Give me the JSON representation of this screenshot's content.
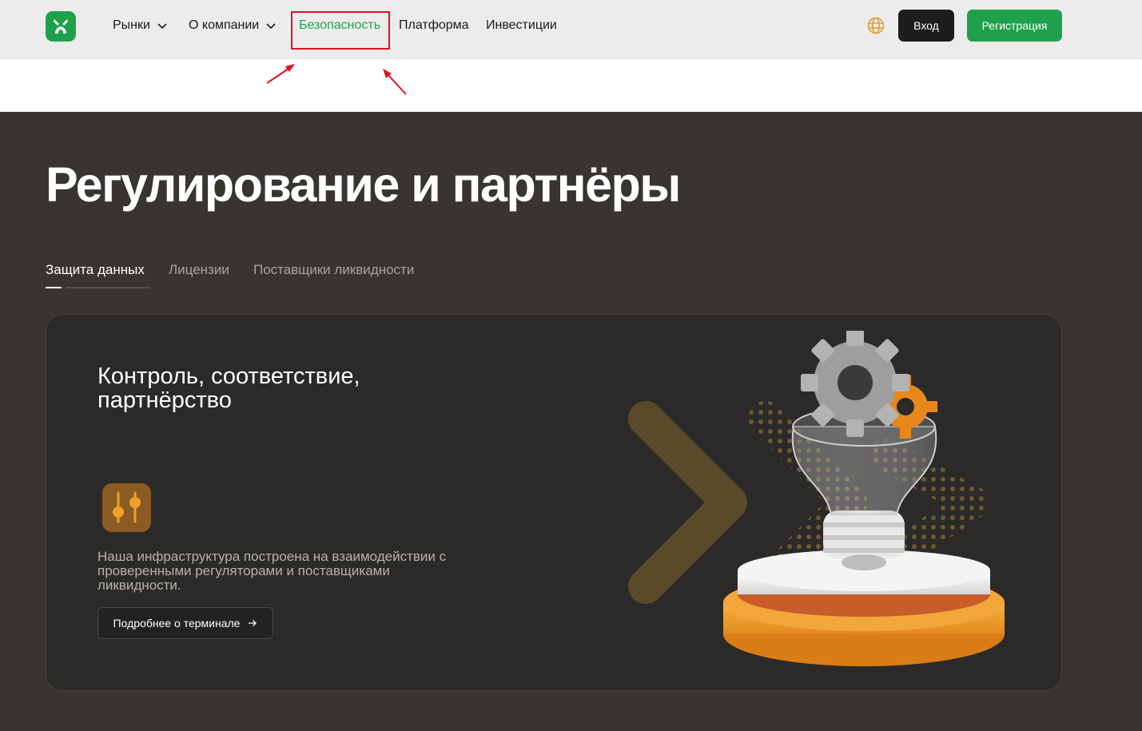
{
  "header": {
    "nav": [
      {
        "label": "Рынки",
        "has_dropdown": true
      },
      {
        "label": "О компании",
        "has_dropdown": true
      },
      {
        "label": "Безопасность",
        "active": true
      },
      {
        "label": "Платформа"
      },
      {
        "label": "Инвестиции"
      }
    ],
    "login_label": "Вход",
    "register_label": "Регистрация"
  },
  "hero": {
    "title": "Регулирование и партнёры",
    "tabs": [
      {
        "label": "Защита данных",
        "active": true
      },
      {
        "label": "Лицензии"
      },
      {
        "label": "Поставщики ликвидности"
      }
    ]
  },
  "card": {
    "title": "Контроль, соответствие, партнёрство",
    "text": "Наша инфраструктура построена на взаимодействии с проверенными регуляторами и поставщиками ликвидности.",
    "button_label": "Подробнее о терминале",
    "button_icon": "arrow-right-icon",
    "feature_icon": "sliders-icon"
  },
  "colors": {
    "brand_green": "#1fa14b",
    "header_bg": "#ececec",
    "page_bg": "#383430",
    "card_bg": "#2b2a29",
    "accent_orange": "#f0a02a",
    "annotation_red": "#e0121f"
  }
}
